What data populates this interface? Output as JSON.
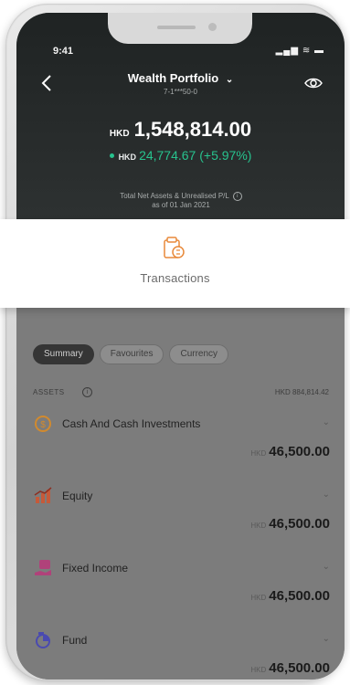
{
  "status": {
    "time": "9:41",
    "icons": "▂▄▆ ≋ ▬"
  },
  "header": {
    "title": "Wealth Portfolio",
    "account": "7-1***50-0"
  },
  "summary": {
    "currency": "HKD",
    "total": "1,548,814.00",
    "gain_currency": "HKD",
    "gain": "24,774.67 (+5.97%)",
    "note_line1": "Total Net Assets & Unrealised P/L",
    "note_line2": "as of 01 Jan 2021"
  },
  "transactions": {
    "label": "Transactions"
  },
  "tabs": [
    {
      "label": "Summary",
      "active": true
    },
    {
      "label": "Favourites",
      "active": false
    },
    {
      "label": "Currency",
      "active": false
    }
  ],
  "assets": {
    "label": "ASSETS",
    "total": "HKD 884,814.42",
    "items": [
      {
        "name": "Cash And Cash Investments",
        "currency": "HKD",
        "value": "46,500.00",
        "icon": "coin-icon"
      },
      {
        "name": "Equity",
        "currency": "HKD",
        "value": "46,500.00",
        "icon": "equity-chart-icon"
      },
      {
        "name": "Fixed Income",
        "currency": "HKD",
        "value": "46,500.00",
        "icon": "fixed-income-icon"
      },
      {
        "name": "Fund",
        "currency": "HKD",
        "value": "46,500.00",
        "icon": "fund-icon"
      }
    ]
  },
  "colors": {
    "hero_bg": "#262a2a",
    "gain_green": "#27c38e",
    "accent_orange": "#e8893a"
  }
}
